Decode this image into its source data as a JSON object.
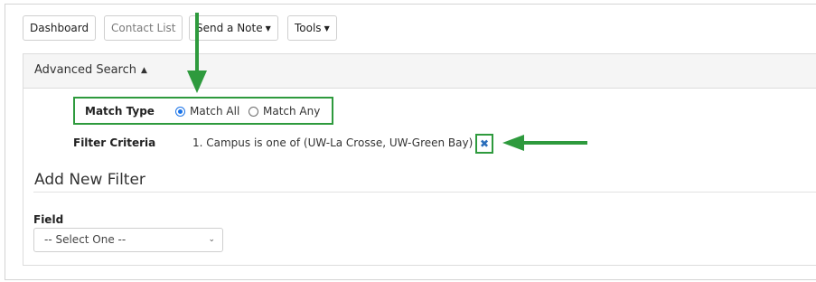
{
  "toolbar": {
    "dashboard": "Dashboard",
    "contact_list": "Contact List",
    "send_note": "Send a Note",
    "tools": "Tools"
  },
  "advanced_search": {
    "title": "Advanced Search",
    "match_type_label": "Match Type",
    "match_all": "Match All",
    "match_any": "Match Any",
    "selected": "Match All",
    "filter_criteria_label": "Filter Criteria",
    "filter_criteria_value": "1. Campus is one of (UW-La Crosse, UW-Green Bay)",
    "remove_icon": "close-icon"
  },
  "add_filter": {
    "title": "Add New Filter",
    "field_label": "Field",
    "field_select_value": "-- Select One --"
  },
  "colors": {
    "highlight_green": "#2e9a3d",
    "radio_blue": "#1a73e8",
    "remove_blue": "#2a6ebb"
  }
}
